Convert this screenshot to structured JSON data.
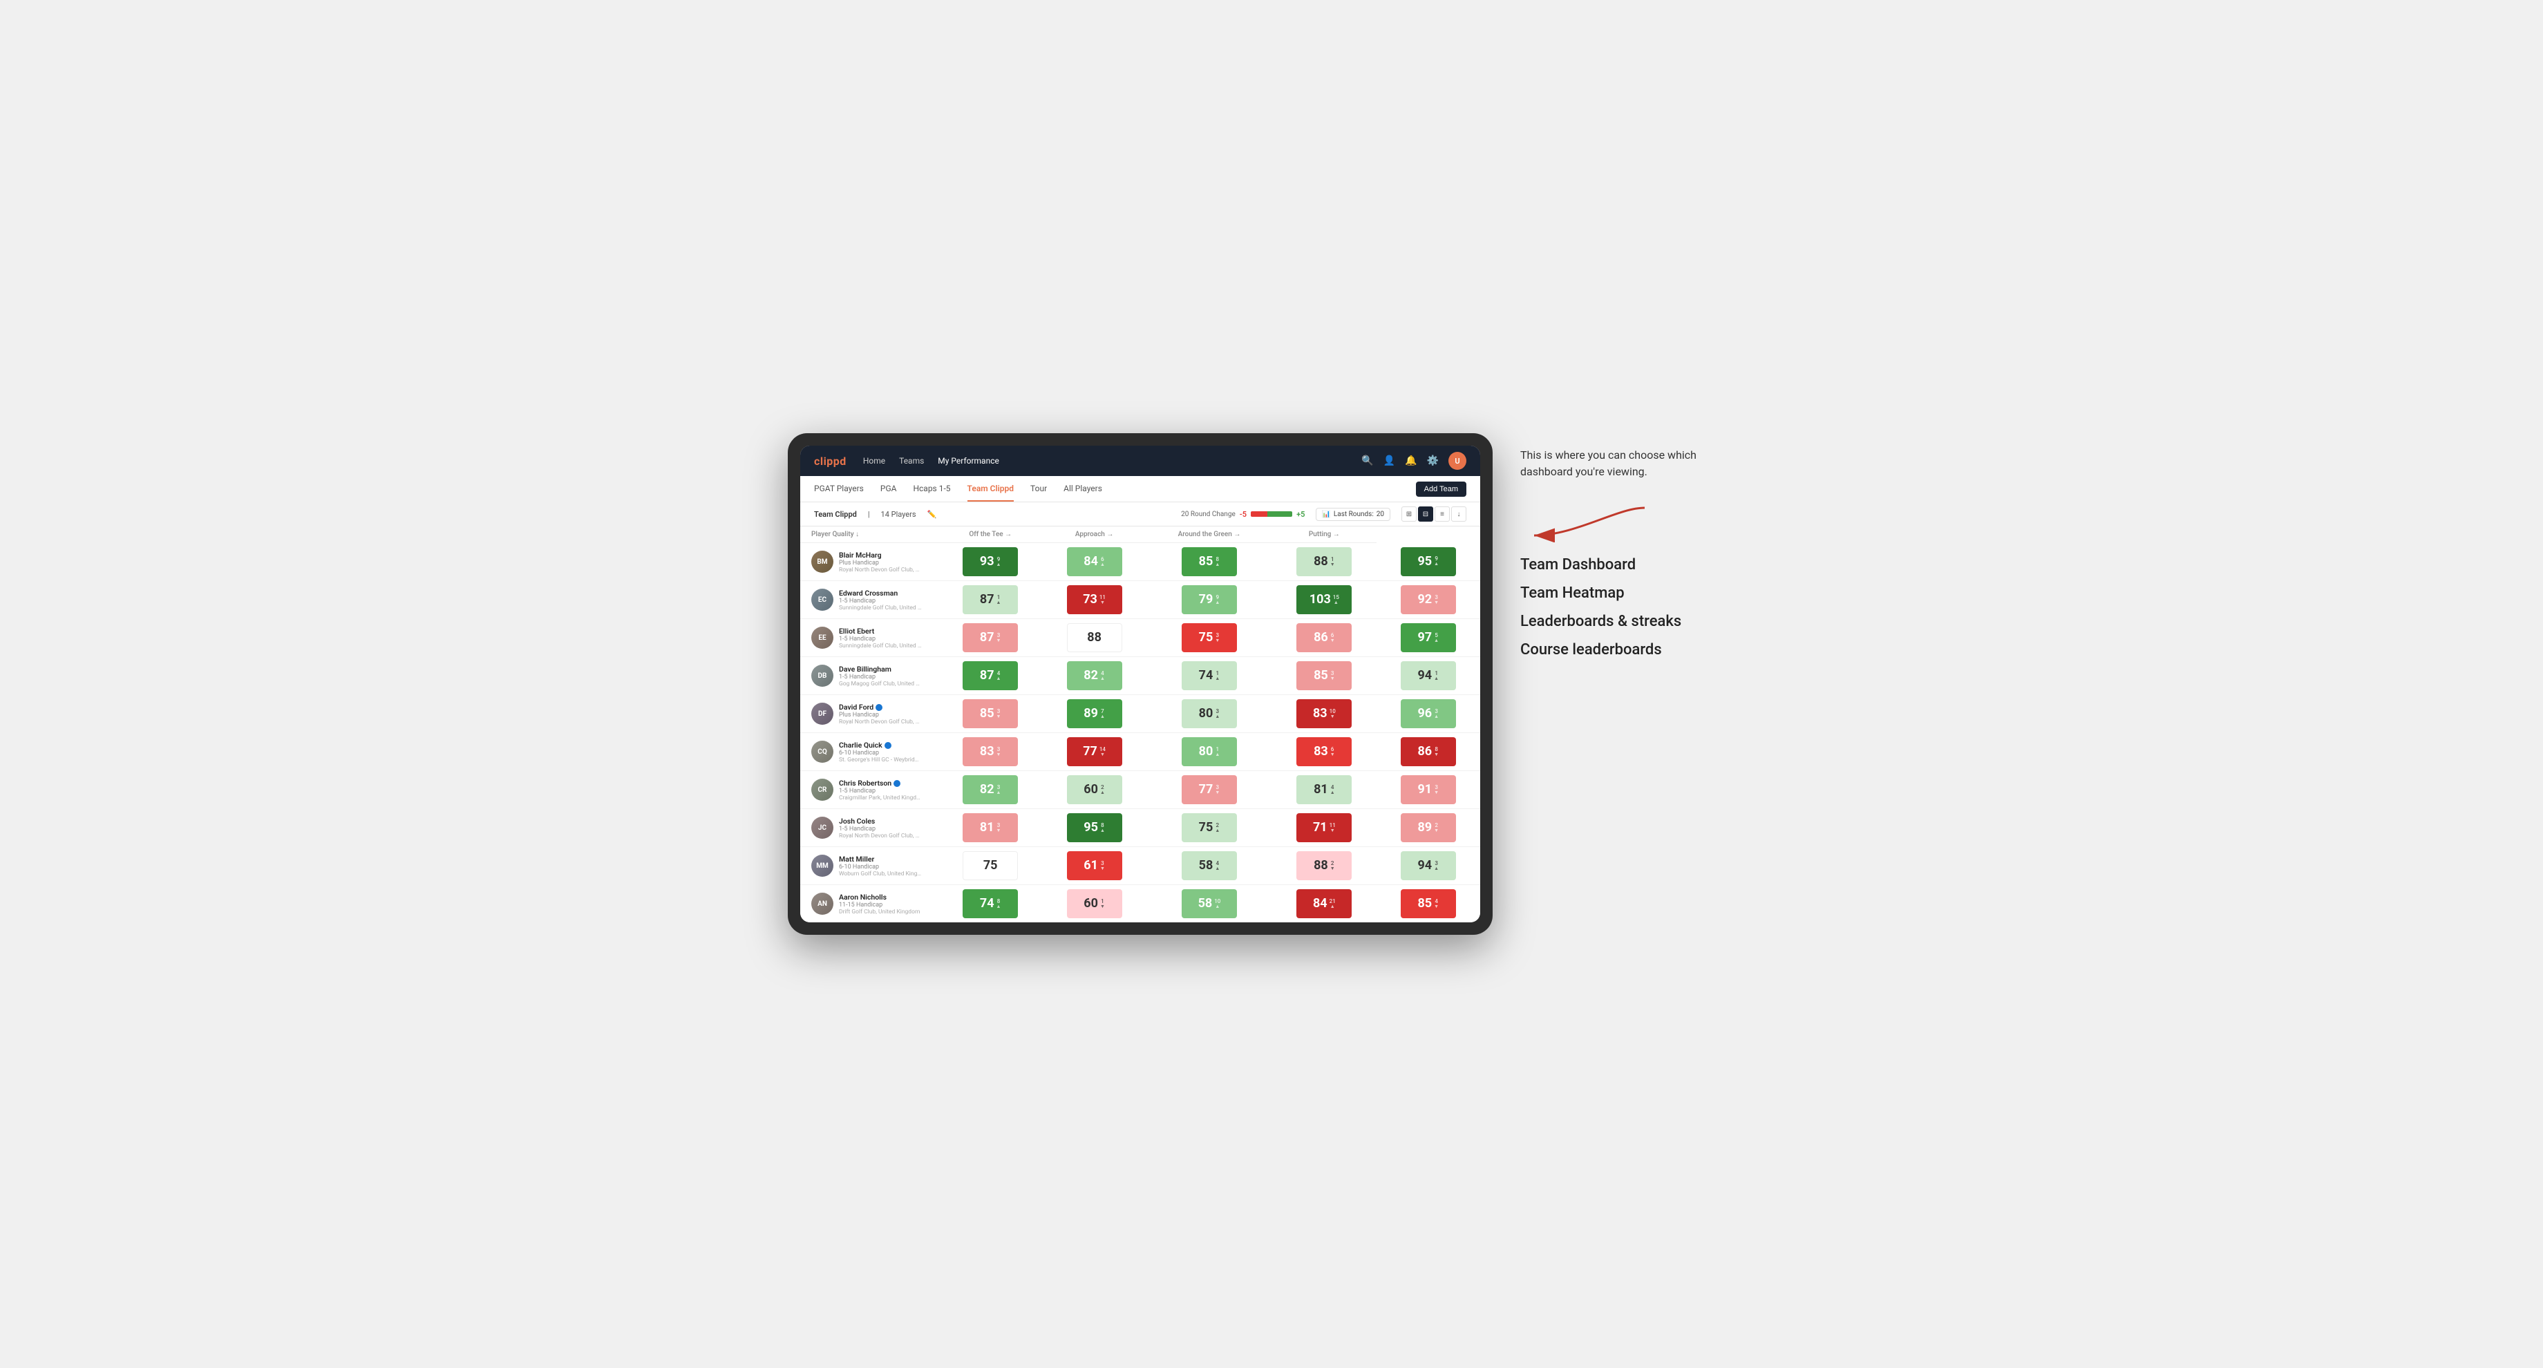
{
  "annotation": {
    "intro_text": "This is where you can choose which dashboard you're viewing.",
    "options": [
      "Team Dashboard",
      "Team Heatmap",
      "Leaderboards & streaks",
      "Course leaderboards"
    ]
  },
  "nav": {
    "logo": "clippd",
    "links": [
      "Home",
      "Teams",
      "My Performance"
    ],
    "active_link": "My Performance"
  },
  "sub_nav": {
    "links": [
      "PGAT Players",
      "PGA",
      "Hcaps 1-5",
      "Team Clippd",
      "Tour",
      "All Players"
    ],
    "active_link": "Team Clippd",
    "add_team_label": "Add Team"
  },
  "team_header": {
    "team_name": "Team Clippd",
    "player_count": "14 Players",
    "round_change_label": "20 Round Change",
    "change_neg": "-5",
    "change_pos": "+5",
    "last_rounds_label": "Last Rounds:",
    "last_rounds_value": "20"
  },
  "table": {
    "col_headers": [
      "Player Quality ↓",
      "Off the Tee →",
      "Approach →",
      "Around the Green →",
      "Putting →"
    ],
    "players": [
      {
        "name": "Blair McHarg",
        "handicap": "Plus Handicap",
        "club": "Royal North Devon Golf Club, United Kingdom",
        "avatar_class": "avatar-blair",
        "initials": "BM",
        "scores": [
          {
            "value": "93",
            "delta": "9",
            "dir": "up",
            "color": "green-dark"
          },
          {
            "value": "84",
            "delta": "6",
            "dir": "up",
            "color": "green-light"
          },
          {
            "value": "85",
            "delta": "8",
            "dir": "up",
            "color": "green-mid"
          },
          {
            "value": "88",
            "delta": "1",
            "dir": "down",
            "color": "light-green"
          },
          {
            "value": "95",
            "delta": "9",
            "dir": "up",
            "color": "green-dark"
          }
        ]
      },
      {
        "name": "Edward Crossman",
        "handicap": "1-5 Handicap",
        "club": "Sunningdale Golf Club, United Kingdom",
        "avatar_class": "avatar-edward",
        "initials": "EC",
        "scores": [
          {
            "value": "87",
            "delta": "1",
            "dir": "up",
            "color": "light-green"
          },
          {
            "value": "73",
            "delta": "11",
            "dir": "down",
            "color": "red-dark"
          },
          {
            "value": "79",
            "delta": "9",
            "dir": "up",
            "color": "green-light"
          },
          {
            "value": "103",
            "delta": "15",
            "dir": "up",
            "color": "green-dark"
          },
          {
            "value": "92",
            "delta": "3",
            "dir": "down",
            "color": "red-light"
          }
        ]
      },
      {
        "name": "Elliot Ebert",
        "handicap": "1-5 Handicap",
        "club": "Sunningdale Golf Club, United Kingdom",
        "avatar_class": "avatar-elliot",
        "initials": "EE",
        "scores": [
          {
            "value": "87",
            "delta": "3",
            "dir": "down",
            "color": "red-light"
          },
          {
            "value": "88",
            "delta": "",
            "dir": "",
            "color": "white"
          },
          {
            "value": "75",
            "delta": "3",
            "dir": "down",
            "color": "red-mid"
          },
          {
            "value": "86",
            "delta": "6",
            "dir": "down",
            "color": "red-light"
          },
          {
            "value": "97",
            "delta": "5",
            "dir": "up",
            "color": "green-mid"
          }
        ]
      },
      {
        "name": "Dave Billingham",
        "handicap": "1-5 Handicap",
        "club": "Gog Magog Golf Club, United Kingdom",
        "avatar_class": "avatar-dave",
        "initials": "DB",
        "scores": [
          {
            "value": "87",
            "delta": "4",
            "dir": "up",
            "color": "green-mid"
          },
          {
            "value": "82",
            "delta": "4",
            "dir": "up",
            "color": "green-light"
          },
          {
            "value": "74",
            "delta": "1",
            "dir": "up",
            "color": "light-green"
          },
          {
            "value": "85",
            "delta": "3",
            "dir": "down",
            "color": "red-light"
          },
          {
            "value": "94",
            "delta": "1",
            "dir": "up",
            "color": "light-green"
          }
        ]
      },
      {
        "name": "David Ford",
        "handicap": "Plus Handicap",
        "club": "Royal North Devon Golf Club, United Kingdom",
        "avatar_class": "avatar-david",
        "initials": "DF",
        "verified": true,
        "scores": [
          {
            "value": "85",
            "delta": "3",
            "dir": "down",
            "color": "red-light"
          },
          {
            "value": "89",
            "delta": "7",
            "dir": "up",
            "color": "green-mid"
          },
          {
            "value": "80",
            "delta": "3",
            "dir": "up",
            "color": "light-green"
          },
          {
            "value": "83",
            "delta": "10",
            "dir": "down",
            "color": "red-dark"
          },
          {
            "value": "96",
            "delta": "3",
            "dir": "up",
            "color": "green-light"
          }
        ]
      },
      {
        "name": "Charlie Quick",
        "handicap": "6-10 Handicap",
        "club": "St. George's Hill GC - Weybridge - Surrey, Uni...",
        "avatar_class": "avatar-charlie",
        "initials": "CQ",
        "verified": true,
        "scores": [
          {
            "value": "83",
            "delta": "3",
            "dir": "down",
            "color": "red-light"
          },
          {
            "value": "77",
            "delta": "14",
            "dir": "down",
            "color": "red-dark"
          },
          {
            "value": "80",
            "delta": "1",
            "dir": "up",
            "color": "green-light"
          },
          {
            "value": "83",
            "delta": "6",
            "dir": "down",
            "color": "red-mid"
          },
          {
            "value": "86",
            "delta": "8",
            "dir": "down",
            "color": "red-dark"
          }
        ]
      },
      {
        "name": "Chris Robertson",
        "handicap": "1-5 Handicap",
        "club": "Craigmillar Park, United Kingdom",
        "avatar_class": "avatar-chris",
        "initials": "CR",
        "verified": true,
        "scores": [
          {
            "value": "82",
            "delta": "3",
            "dir": "up",
            "color": "green-light"
          },
          {
            "value": "60",
            "delta": "2",
            "dir": "up",
            "color": "light-green"
          },
          {
            "value": "77",
            "delta": "3",
            "dir": "down",
            "color": "red-light"
          },
          {
            "value": "81",
            "delta": "4",
            "dir": "up",
            "color": "light-green"
          },
          {
            "value": "91",
            "delta": "3",
            "dir": "down",
            "color": "red-light"
          }
        ]
      },
      {
        "name": "Josh Coles",
        "handicap": "1-5 Handicap",
        "club": "Royal North Devon Golf Club, United Kingdom",
        "avatar_class": "avatar-josh",
        "initials": "JC",
        "scores": [
          {
            "value": "81",
            "delta": "3",
            "dir": "down",
            "color": "red-light"
          },
          {
            "value": "95",
            "delta": "8",
            "dir": "up",
            "color": "green-dark"
          },
          {
            "value": "75",
            "delta": "2",
            "dir": "up",
            "color": "light-green"
          },
          {
            "value": "71",
            "delta": "11",
            "dir": "down",
            "color": "red-dark"
          },
          {
            "value": "89",
            "delta": "2",
            "dir": "down",
            "color": "red-light"
          }
        ]
      },
      {
        "name": "Matt Miller",
        "handicap": "6-10 Handicap",
        "club": "Woburn Golf Club, United Kingdom",
        "avatar_class": "avatar-matt",
        "initials": "MM",
        "scores": [
          {
            "value": "75",
            "delta": "",
            "dir": "",
            "color": "white"
          },
          {
            "value": "61",
            "delta": "3",
            "dir": "down",
            "color": "red-mid"
          },
          {
            "value": "58",
            "delta": "4",
            "dir": "up",
            "color": "light-green"
          },
          {
            "value": "88",
            "delta": "2",
            "dir": "down",
            "color": "light-red"
          },
          {
            "value": "94",
            "delta": "3",
            "dir": "up",
            "color": "light-green"
          }
        ]
      },
      {
        "name": "Aaron Nicholls",
        "handicap": "11-15 Handicap",
        "club": "Drift Golf Club, United Kingdom",
        "avatar_class": "avatar-aaron",
        "initials": "AN",
        "scores": [
          {
            "value": "74",
            "delta": "8",
            "dir": "up",
            "color": "green-mid"
          },
          {
            "value": "60",
            "delta": "1",
            "dir": "down",
            "color": "light-red"
          },
          {
            "value": "58",
            "delta": "10",
            "dir": "up",
            "color": "green-light"
          },
          {
            "value": "84",
            "delta": "21",
            "dir": "up",
            "color": "red-dark"
          },
          {
            "value": "85",
            "delta": "4",
            "dir": "down",
            "color": "red-mid"
          }
        ]
      }
    ]
  }
}
